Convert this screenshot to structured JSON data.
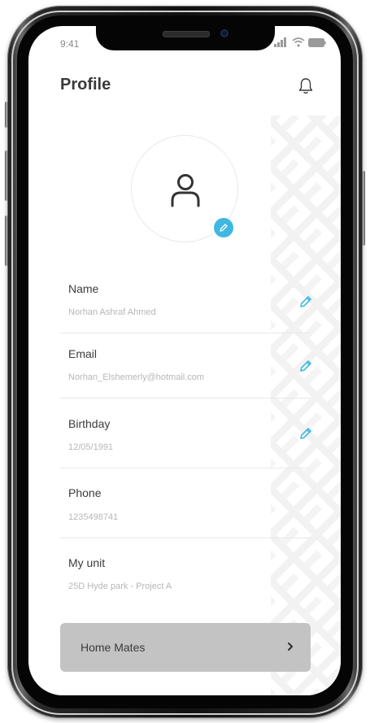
{
  "status_bar": {
    "time": "9:41"
  },
  "header": {
    "title": "Profile",
    "notification_icon": "bell-icon"
  },
  "profile": {
    "avatar_icon": "user-icon",
    "avatar_edit_icon": "pencil-icon"
  },
  "fields": [
    {
      "label": "Name",
      "value": "Norhan Ashraf Ahmed",
      "editable": true
    },
    {
      "label": "Email",
      "value": "Norhan_Elshemerly@hotmail.com",
      "editable": true
    },
    {
      "label": "Birthday",
      "value": "12/05/1991",
      "editable": true
    },
    {
      "label": "Phone",
      "value": "1235498741",
      "editable": false
    },
    {
      "label": "My unit",
      "value": "25D Hyde park - Project A",
      "editable": false
    }
  ],
  "home_mates": {
    "label": "Home Mates",
    "icon": "chevron-right-icon"
  },
  "colors": {
    "accent": "#3fb8e1",
    "button_bg": "#c3c3c3",
    "label_text": "#3c3c3c",
    "value_text": "#b7b7b7"
  }
}
